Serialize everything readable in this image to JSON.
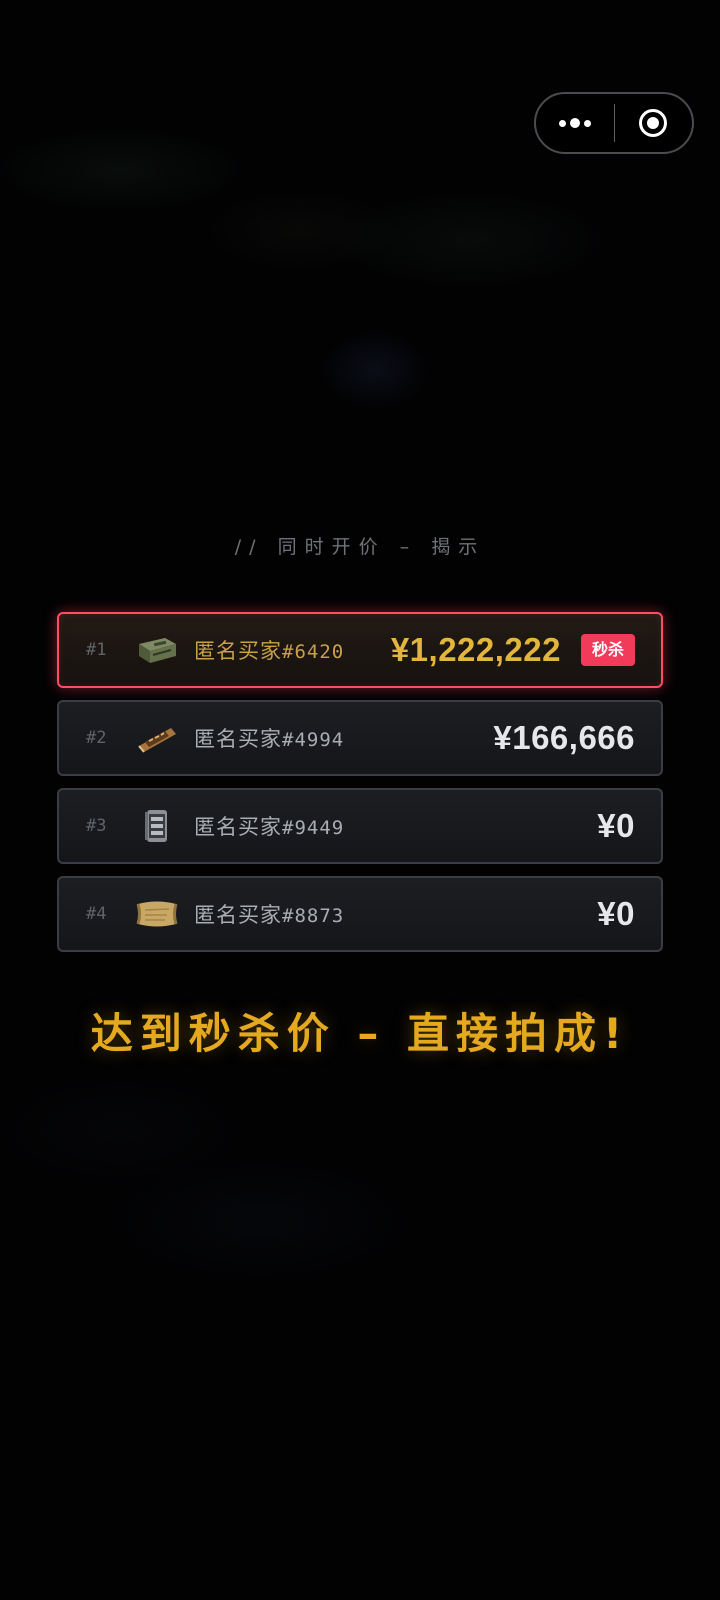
{
  "capsule": {
    "menu_icon": "more-dots-icon",
    "close_icon": "target-close-icon"
  },
  "reveal": {
    "title": "// 同时开价 – 揭示"
  },
  "bids": [
    {
      "rank": "#1",
      "item_icon": "ammo-box-icon",
      "buyer_name": "匿名买家",
      "buyer_tag": "#6420",
      "price": "¥1,222,222",
      "badge": "秒杀",
      "winner": true
    },
    {
      "rank": "#2",
      "item_icon": "ration-bar-icon",
      "buyer_name": "匿名买家",
      "buyer_tag": "#4994",
      "price": "¥166,666",
      "winner": false
    },
    {
      "rank": "#3",
      "item_icon": "metal-canister-icon",
      "buyer_name": "匿名买家",
      "buyer_tag": "#9449",
      "price": "¥0",
      "winner": false
    },
    {
      "rank": "#4",
      "item_icon": "scroll-map-icon",
      "buyer_name": "匿名买家",
      "buyer_tag": "#8873",
      "price": "¥0",
      "winner": false
    }
  ],
  "banner": {
    "text": "达到秒杀价 – 直接拍成!"
  },
  "colors": {
    "accent_gold": "#e2b53c",
    "winner_border": "#ff4d63",
    "badge_bg": "#f23a5a"
  }
}
